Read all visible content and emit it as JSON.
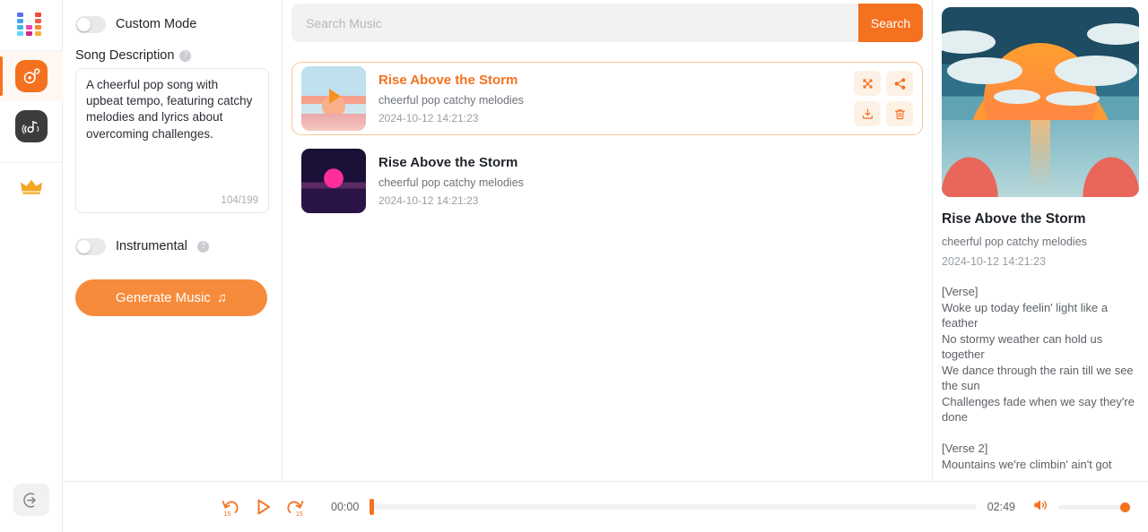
{
  "rail": {
    "logo_name": "equalizer-logo",
    "items": [
      {
        "name": "music-generator",
        "icon": "music-disc-icon",
        "active": true
      },
      {
        "name": "sound-effects",
        "icon": "sound-wave-note-icon",
        "active": false
      }
    ],
    "premium_label": "crown-icon",
    "collapse_label": "sign-in-icon"
  },
  "form": {
    "custom_mode": {
      "label": "Custom Mode",
      "enabled": false
    },
    "song_description": {
      "label": "Song Description",
      "value": "A cheerful pop song with upbeat tempo, featuring catchy melodies and lyrics about overcoming challenges.",
      "char_count": "104/199",
      "help": "?"
    },
    "instrumental": {
      "label": "Instrumental",
      "enabled": false,
      "help": "?"
    },
    "generate_button": "Generate Music",
    "generate_icon": "♫"
  },
  "search": {
    "placeholder": "Search Music",
    "value": "",
    "button_label": "Search"
  },
  "songs": [
    {
      "title": "Rise Above the Storm",
      "tags": "cheerful pop catchy melodies",
      "date": "2024-10-12 14:21:23",
      "selected": true,
      "playing": true,
      "thumb": "sunrise"
    },
    {
      "title": "Rise Above the Storm",
      "tags": "cheerful pop catchy melodies",
      "date": "2024-10-12 14:21:23",
      "selected": false,
      "playing": false,
      "thumb": "night"
    }
  ],
  "card_actions": [
    {
      "name": "expand-button",
      "icon": "expand-icon"
    },
    {
      "name": "share-button",
      "icon": "share-icon"
    },
    {
      "name": "download-button",
      "icon": "download-icon"
    },
    {
      "name": "delete-button",
      "icon": "trash-icon"
    }
  ],
  "detail": {
    "cover_alt": "sunset-over-ocean-cover-art",
    "title": "Rise Above the Storm",
    "tags": "cheerful pop catchy melodies",
    "date": "2024-10-12 14:21:23",
    "lyrics": "[Verse]\nWoke up today feelin' light like a feather\nNo stormy weather can hold us together\nWe dance through the rain till we see the sun\nChallenges fade when we say they're done\n\n[Verse 2]\nMountains we're climbin' ain't got"
  },
  "player": {
    "rewind_label": "15",
    "forward_label": "15",
    "current_time": "00:00",
    "total_time": "02:49",
    "progress_percent": 0,
    "volume_percent": 100,
    "is_playing": false
  },
  "colors": {
    "accent": "#f4711f",
    "accent_soft": "#f68b3c",
    "accent_bg": "#fdf1e6",
    "border": "#ececec"
  }
}
